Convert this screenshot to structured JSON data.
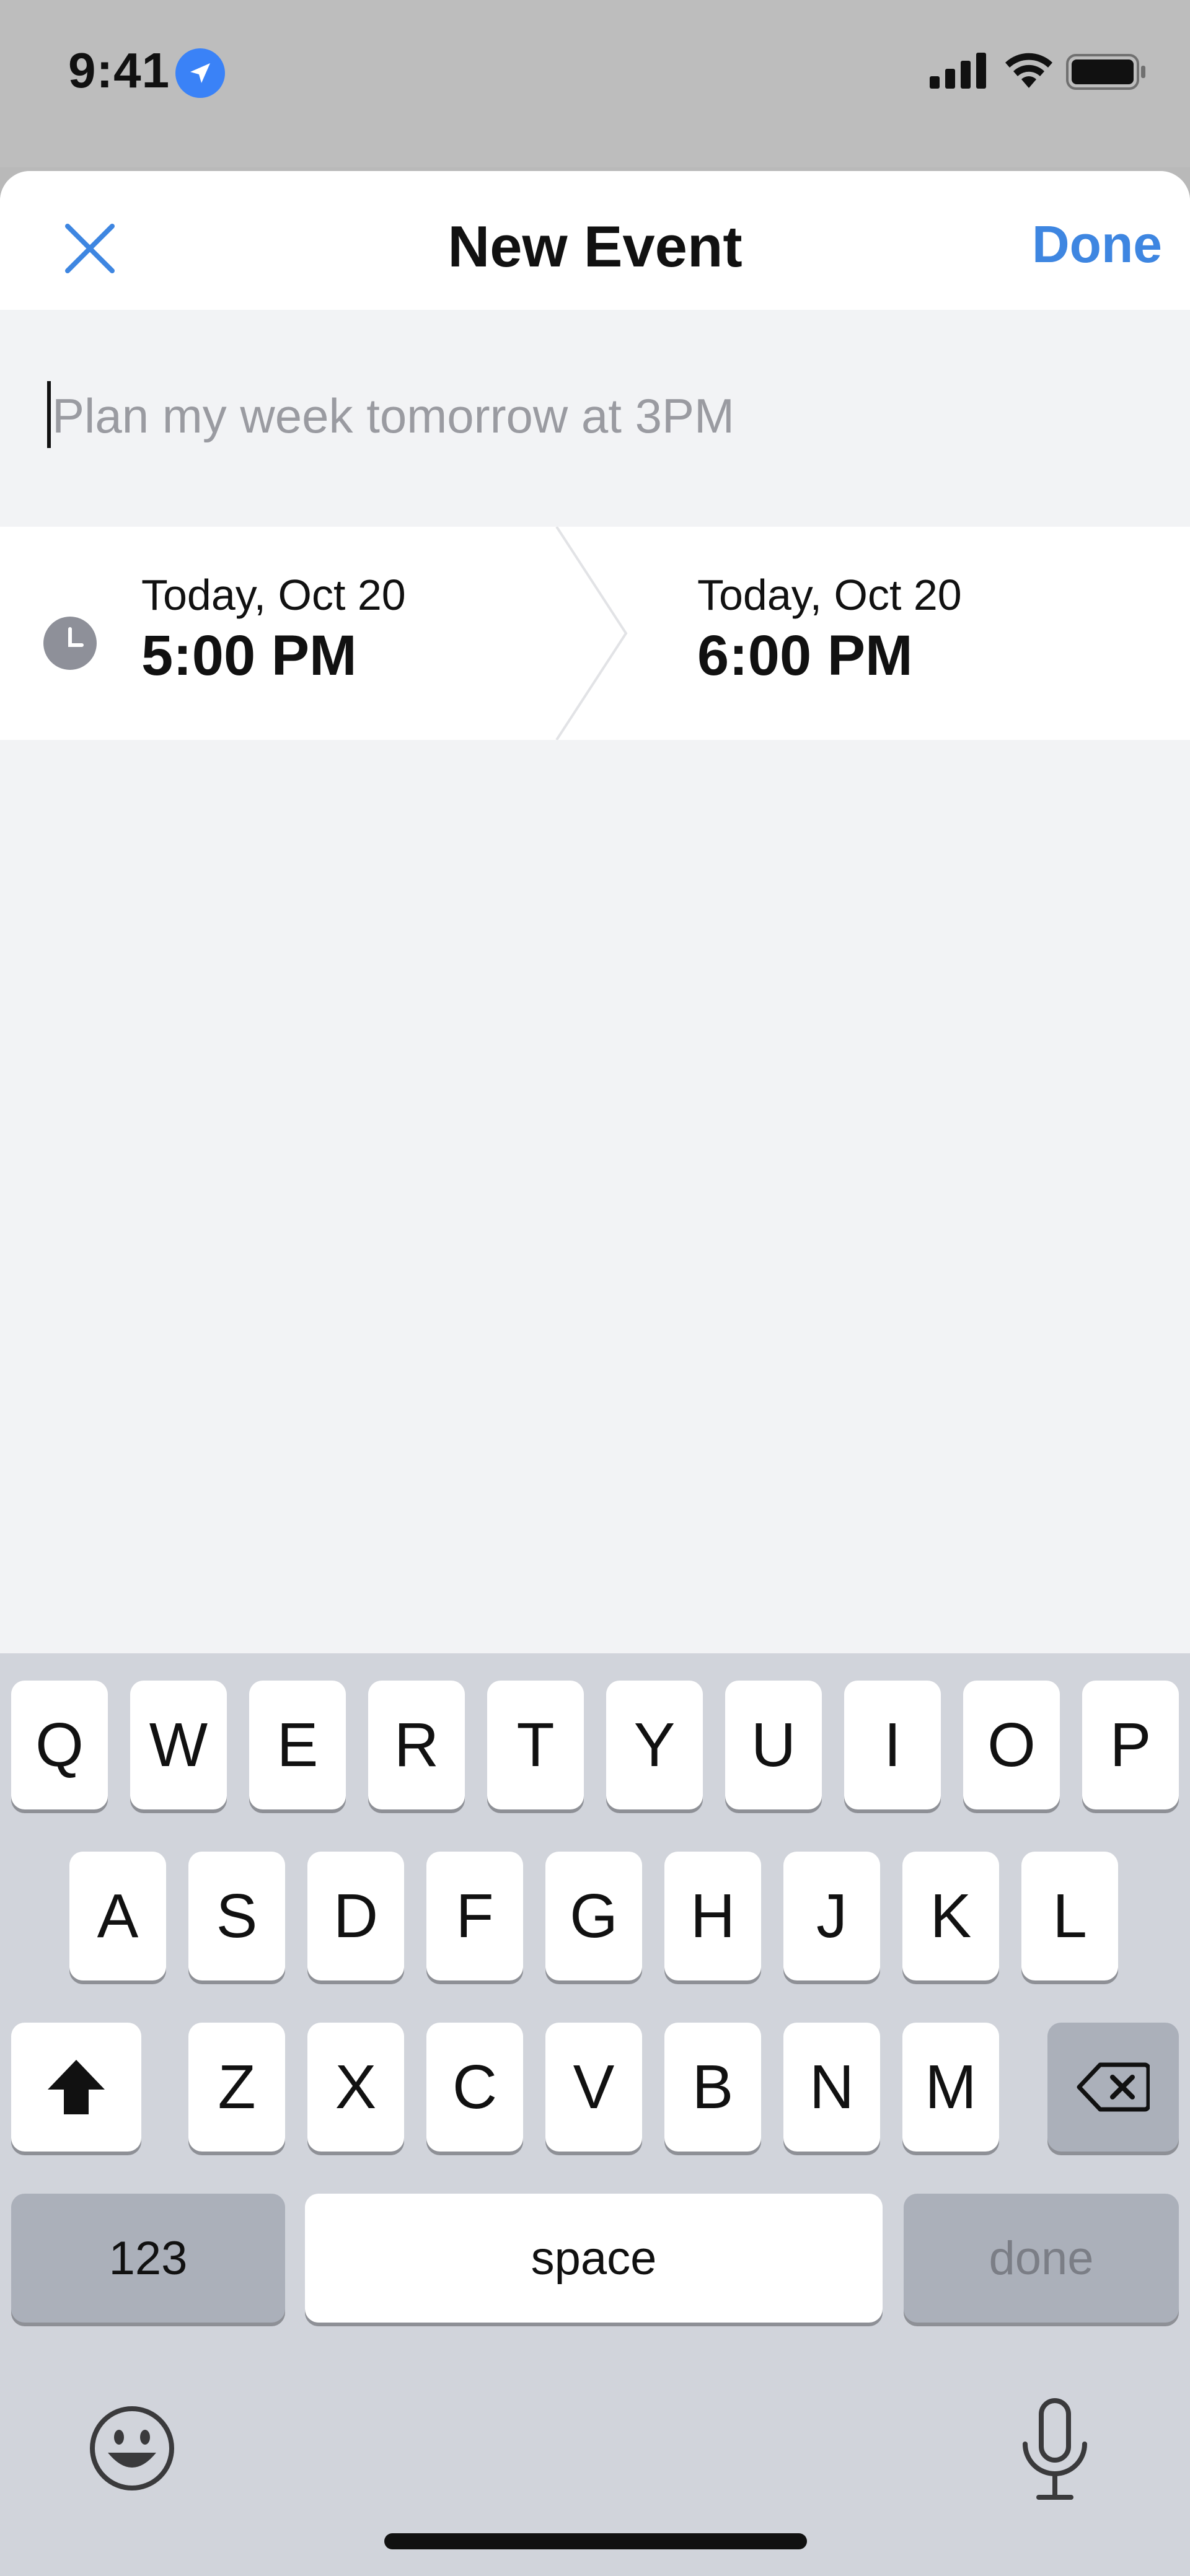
{
  "status_bar": {
    "time": "9:41",
    "icons": [
      "location-arrow-icon",
      "cellular-signal-icon",
      "wifi-icon",
      "battery-icon"
    ]
  },
  "nav": {
    "title": "New Event",
    "done_label": "Done",
    "close_icon": "close-x-icon"
  },
  "event": {
    "title_placeholder": "Plan my week tomorrow at 3PM",
    "title_value": "",
    "start": {
      "date": "Today, Oct 20",
      "time": "5:00 PM"
    },
    "end": {
      "date": "Today, Oct 20",
      "time": "6:00 PM"
    }
  },
  "keyboard": {
    "row1": [
      "Q",
      "W",
      "E",
      "R",
      "T",
      "Y",
      "U",
      "I",
      "O",
      "P"
    ],
    "row2": [
      "A",
      "S",
      "D",
      "F",
      "G",
      "H",
      "J",
      "K",
      "L"
    ],
    "row3": [
      "Z",
      "X",
      "C",
      "V",
      "B",
      "N",
      "M"
    ],
    "numbers_label": "123",
    "space_label": "space",
    "return_label": "done"
  },
  "colors": {
    "accent": "#3e86e1",
    "location": "#3a82f7",
    "sheet_bg": "#f2f3f5",
    "keyboard_bg": "#d1d4db",
    "placeholder": "#9a9ba1"
  }
}
